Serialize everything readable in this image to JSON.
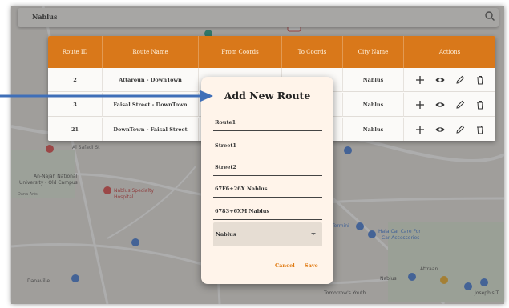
{
  "search": {
    "value": "Nablus"
  },
  "map_labels": {
    "al_safadi": "Al Safadi St",
    "an_najah": "An-Najah National",
    "an_najah_2": "University - Old Campus",
    "hospital": "Nablus Specialty",
    "hospital_2": "Hospital",
    "dana": "Dana Arts",
    "danaville": "Danaville",
    "termini": "Termini",
    "car_care": "Hala Car Care For",
    "car_care_2": "Car Accessories",
    "nablus": "Nablus",
    "attraan": "Attraan",
    "tomorrow": "Tomorrow's Youth",
    "joseph": "Joseph's T"
  },
  "table": {
    "columns": [
      "Route ID",
      "Route Name",
      "From Coords",
      "To Coords",
      "City Name",
      "Actions"
    ],
    "rows": [
      {
        "id": "2",
        "name": "Attaroun - DownTown",
        "from": "",
        "to": "ns",
        "city": "Nablus"
      },
      {
        "id": "3",
        "name": "Faisal Street - DownTown",
        "from": "",
        "to": "ns",
        "city": "Nablus"
      },
      {
        "id": "21",
        "name": "DownTown - Faisal Street",
        "from": "",
        "to": "ns",
        "city": "Nablus"
      }
    ]
  },
  "modal": {
    "title": "Add New Route",
    "fields": [
      "Route1",
      "Street1",
      "Street2",
      "67F6+26X Nablus",
      "6783+6XM Nablus"
    ],
    "city_selected": "Nablus",
    "cancel_label": "Cancel",
    "save_label": "Save"
  },
  "icons": {
    "add": "plus-icon",
    "view": "eye-icon",
    "edit": "pencil-icon",
    "delete": "trash-icon",
    "search": "search-icon"
  },
  "colors": {
    "table_header": "#d9781a",
    "action_button": "#e07a12",
    "arrow": "#3f6fb8"
  }
}
